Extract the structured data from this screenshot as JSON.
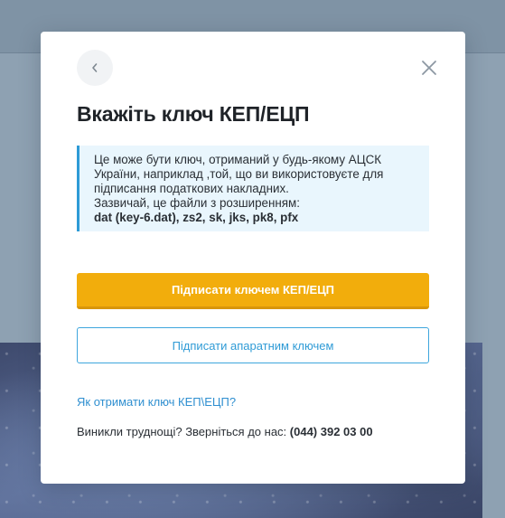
{
  "modal": {
    "title": "Вкажіть ключ КЕП/ЕЦП",
    "info": {
      "line1": "Це може бути ключ, отриманий у будь-якому АЦСК",
      "line2": "України, наприклад ,той, що ви використовуєте для",
      "line3": "підписання податкових накладних.",
      "line4": "Зазвичай, це файли з розширенням:",
      "extensions": "dat (key-6.dat), zs2, sk, jks, pk8, pfx"
    },
    "primary_button_label": "Підписати ключем КЕП/ЕЦП",
    "secondary_button_label": "Підписати апаратним ключем",
    "help_link_label": "Як отримати ключ КЕП\\ЕЦП?",
    "contact_text": "Виникли труднощі? Зверніться до нас: ",
    "contact_phone": "(044) 392 03 00",
    "back_icon": "chevron-left-icon",
    "close_icon": "close-icon"
  },
  "colors": {
    "primary": "#f2ad0c",
    "accent": "#2f9bd6",
    "info_background": "#e9f6fd",
    "overlay": "#8ea1b2"
  }
}
